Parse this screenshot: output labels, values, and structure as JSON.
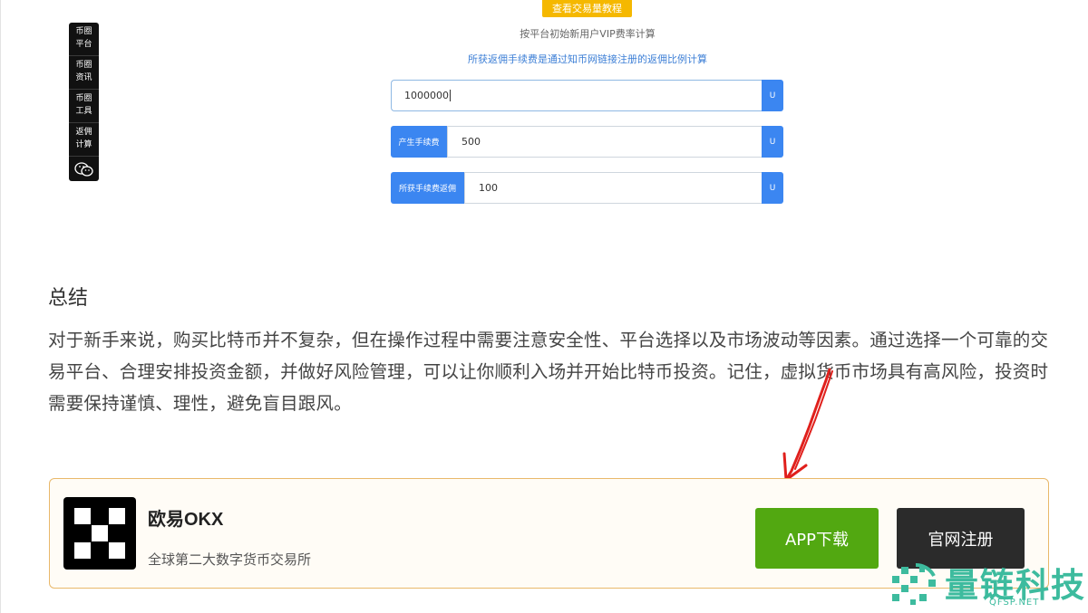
{
  "sidenav": {
    "items": [
      {
        "line1": "币圈",
        "line2": "平台"
      },
      {
        "line1": "币圈",
        "line2": "资讯"
      },
      {
        "line1": "币圈",
        "line2": "工具"
      },
      {
        "line1": "返佣",
        "line2": "计算"
      }
    ],
    "wechat_icon": "wechat-icon"
  },
  "calculator": {
    "tutorial_button": "查看交易量教程",
    "note_vip": "按平台初始新用户VIP费率计算",
    "note_rebate": "所获返佣手续费是通过知币网链接注册的返佣比例计算",
    "volume_value": "1000000",
    "fee_label": "产生手续费",
    "fee_value": "500",
    "rebate_label": "所获手续费返佣",
    "rebate_value": "100",
    "unit": "U"
  },
  "article": {
    "summary_title": "总结",
    "summary_text": "对于新手来说，购买比特币并不复杂，但在操作过程中需要注意安全性、平台选择以及市场波动等因素。通过选择一个可靠的交易平台、合理安排投资金额，并做好风险管理，可以让你顺利入场并开始比特币投资。记住，虚拟货币市场具有高风险，投资时需要保持谨慎、理性，避免盲目跟风。"
  },
  "exchange_card": {
    "name": "欧易OKX",
    "description": "全球第二大数字货币交易所",
    "app_button": "APP下载",
    "register_button": "官网注册"
  },
  "watermark": {
    "text": "量链科技",
    "sub": "QFSP.NET"
  },
  "colors": {
    "accent_blue": "#3b86f1",
    "tutorial_yellow": "#f5b800",
    "app_green": "#52a811",
    "card_border": "#e9b86a",
    "arrow_red": "#e0201c"
  }
}
